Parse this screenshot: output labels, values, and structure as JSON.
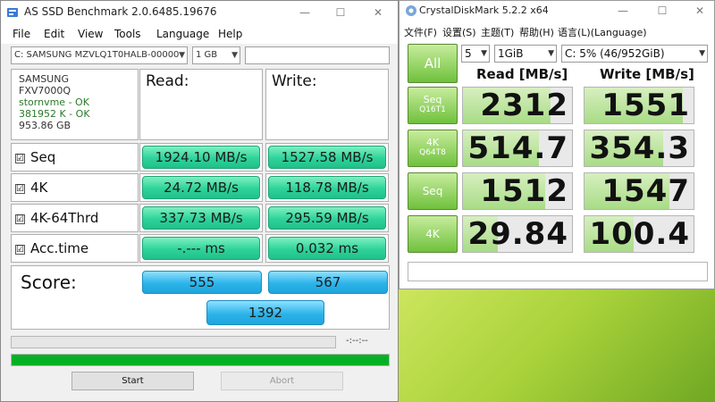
{
  "asssd": {
    "title": "AS SSD Benchmark 2.0.6485.19676",
    "menu": [
      "File",
      "Edit",
      "View",
      "Tools",
      "Language",
      "Help"
    ],
    "drive_select": "C: SAMSUNG MZVLQ1T0HALB-00000",
    "size_select": "1 GB",
    "search_value": "",
    "info": {
      "vendor": "SAMSUNG",
      "firmware": "FXV7000Q",
      "driver": "stornvme - OK",
      "alignment": "381952 K - OK",
      "capacity": "953.86 GB"
    },
    "headers": {
      "read": "Read:",
      "write": "Write:"
    },
    "rows": [
      {
        "label": "Seq",
        "checked": "☑",
        "read": "1924.10 MB/s",
        "write": "1527.58 MB/s"
      },
      {
        "label": "4K",
        "checked": "☑",
        "read": "24.72 MB/s",
        "write": "118.78 MB/s"
      },
      {
        "label": "4K-64Thrd",
        "checked": "☑",
        "read": "337.73 MB/s",
        "write": "295.59 MB/s"
      },
      {
        "label": "Acc.time",
        "checked": "☑",
        "read": "-.--- ms",
        "write": "0.032 ms"
      }
    ],
    "score_label": "Score:",
    "score": {
      "read": "555",
      "write": "567",
      "total": "1392"
    },
    "elapsed": "-:--:--",
    "progress_fraction": 1.0,
    "buttons": {
      "start": "Start",
      "abort": "Abort"
    }
  },
  "cdm": {
    "title": "CrystalDiskMark 5.2.2 x64",
    "menu": [
      "文件(F)",
      "设置(S)",
      "主题(T)",
      "帮助(H)",
      "语言(L)(Language)"
    ],
    "count_select": "5",
    "size_select": "1GiB",
    "drive_select": "C: 5% (46/952GiB)",
    "all_button": "All",
    "headers": {
      "read": "Read [MB/s]",
      "write": "Write [MB/s]"
    },
    "tests": [
      {
        "name": "Seq",
        "sub": "Q16T1",
        "read": "2312",
        "write": "1551",
        "read_fill": 0.8,
        "write_fill": 0.9
      },
      {
        "name": "4K",
        "sub": "Q64T8",
        "read": "514.7",
        "write": "354.3",
        "read_fill": 0.7,
        "write_fill": 0.72
      },
      {
        "name": "Seq",
        "sub": "",
        "read": "1512",
        "write": "1547",
        "read_fill": 0.75,
        "write_fill": 0.78
      },
      {
        "name": "4K",
        "sub": "",
        "read": "29.84",
        "write": "100.4",
        "read_fill": 0.32,
        "write_fill": 0.45
      }
    ],
    "comment": ""
  },
  "colors": {
    "green_value": "#2ed39a",
    "blue_score": "#2cb4ea",
    "progress_green": "#06b025",
    "cdm_button_green": "#6fc13c",
    "cdm_bar_green": "#a8dc86"
  }
}
